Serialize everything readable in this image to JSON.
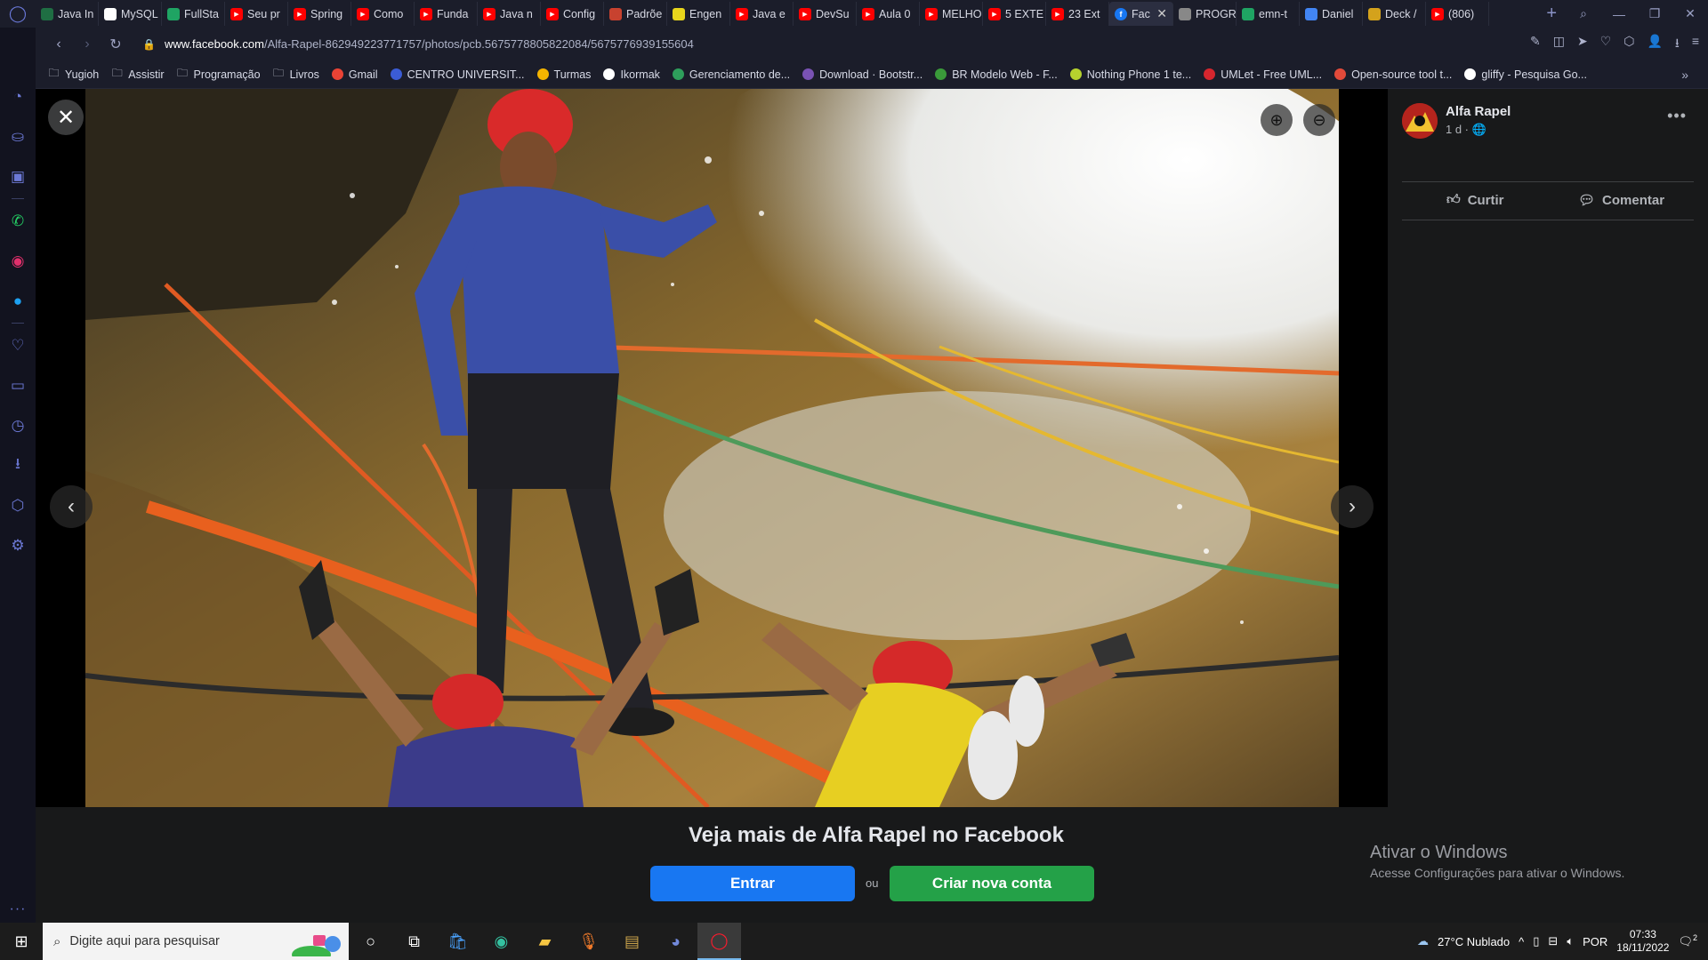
{
  "browser": {
    "tabs": [
      {
        "label": "",
        "favicon": "opera-icon",
        "color": "#1b1d2a"
      },
      {
        "label": "Java In",
        "favicon": "w-icon",
        "color": "#1f6e43"
      },
      {
        "label": "MySQL",
        "favicon": "youtube-icon",
        "color": "#ffffff"
      },
      {
        "label": "FullSta",
        "favicon": "drive-icon",
        "color": "#1fa463"
      },
      {
        "label": "Seu pr",
        "favicon": "youtube-icon",
        "color": "#ff0000"
      },
      {
        "label": "Spring",
        "favicon": "youtube-icon",
        "color": "#ff0000"
      },
      {
        "label": "Como",
        "favicon": "youtube-icon",
        "color": "#ff0000"
      },
      {
        "label": "Funda",
        "favicon": "youtube-icon",
        "color": "#ff0000"
      },
      {
        "label": "Java n",
        "favicon": "youtube-icon",
        "color": "#ff0000"
      },
      {
        "label": "Config",
        "favicon": "youtube-icon",
        "color": "#ff0000"
      },
      {
        "label": "Padrõe",
        "favicon": "doc-icon",
        "color": "#c8422f"
      },
      {
        "label": "Engen",
        "favicon": "es-icon",
        "color": "#e7d51c"
      },
      {
        "label": "Java e",
        "favicon": "youtube-icon",
        "color": "#ff0000"
      },
      {
        "label": "DevSu",
        "favicon": "youtube-icon",
        "color": "#ff0000"
      },
      {
        "label": "Aula 0",
        "favicon": "youtube-icon",
        "color": "#ff0000"
      },
      {
        "label": "MELHO",
        "favicon": "youtube-icon",
        "color": "#ff0000"
      },
      {
        "label": "5 EXTE",
        "favicon": "youtube-icon",
        "color": "#ff0000"
      },
      {
        "label": "23 Ext",
        "favicon": "youtube-icon",
        "color": "#ff0000"
      },
      {
        "label": "Fac",
        "favicon": "facebook-icon",
        "color": "#1877f2",
        "active": true
      },
      {
        "label": "PROGR",
        "favicon": "image-icon",
        "color": "#888888"
      },
      {
        "label": "emn-t",
        "favicon": "drive-icon",
        "color": "#1fa463"
      },
      {
        "label": "Daniel",
        "favicon": "docs-icon",
        "color": "#4285f4"
      },
      {
        "label": "Deck /",
        "favicon": "yugioh-icon",
        "color": "#d4a21c"
      },
      {
        "label": "(806)",
        "favicon": "youtube-icon",
        "color": "#ff0000"
      }
    ],
    "url_domain": "www.facebook.com",
    "url_path": "/Alfa-Rapel-862949223771757/photos/pcb.5675778805822084/5675776939155604"
  },
  "bookmarks": [
    {
      "label": "Yugioh",
      "icon": "folder-icon"
    },
    {
      "label": "Assistir",
      "icon": "folder-icon"
    },
    {
      "label": "Programação",
      "icon": "folder-icon"
    },
    {
      "label": "Livros",
      "icon": "folder-icon"
    },
    {
      "label": "Gmail",
      "icon": "gmail-icon"
    },
    {
      "label": "CENTRO UNIVERSIT...",
      "icon": "globe-icon"
    },
    {
      "label": "Turmas",
      "icon": "classroom-icon"
    },
    {
      "label": "Ikormak",
      "icon": "github-icon"
    },
    {
      "label": "Gerenciamento de...",
      "icon": "leaf-icon"
    },
    {
      "label": "Download · Bootstr...",
      "icon": "bootstrap-icon"
    },
    {
      "label": "BR Modelo Web - F...",
      "icon": "br-icon"
    },
    {
      "label": "Nothing Phone 1 te...",
      "icon": "t-icon"
    },
    {
      "label": "UMLet - Free UML...",
      "icon": "umlet-icon"
    },
    {
      "label": "Open-source tool t...",
      "icon": "chart-icon"
    },
    {
      "label": "gliffy - Pesquisa Go...",
      "icon": "google-icon"
    }
  ],
  "post": {
    "page_name": "Alfa Rapel",
    "time": "1 d ·",
    "like_label": "Curtir",
    "comment_label": "Comentar"
  },
  "login": {
    "title": "Veja mais de Alfa Rapel no Facebook",
    "login_label": "Entrar",
    "or_label": "ou",
    "signup_label": "Criar nova conta"
  },
  "windows_activation": {
    "title": "Ativar o Windows",
    "subtitle": "Acesse Configurações para ativar o Windows."
  },
  "taskbar": {
    "search_placeholder": "Digite aqui para pesquisar",
    "weather": "27°C  Nublado",
    "language": "POR",
    "time": "07:33",
    "date": "18/11/2022",
    "notifications": "2"
  }
}
